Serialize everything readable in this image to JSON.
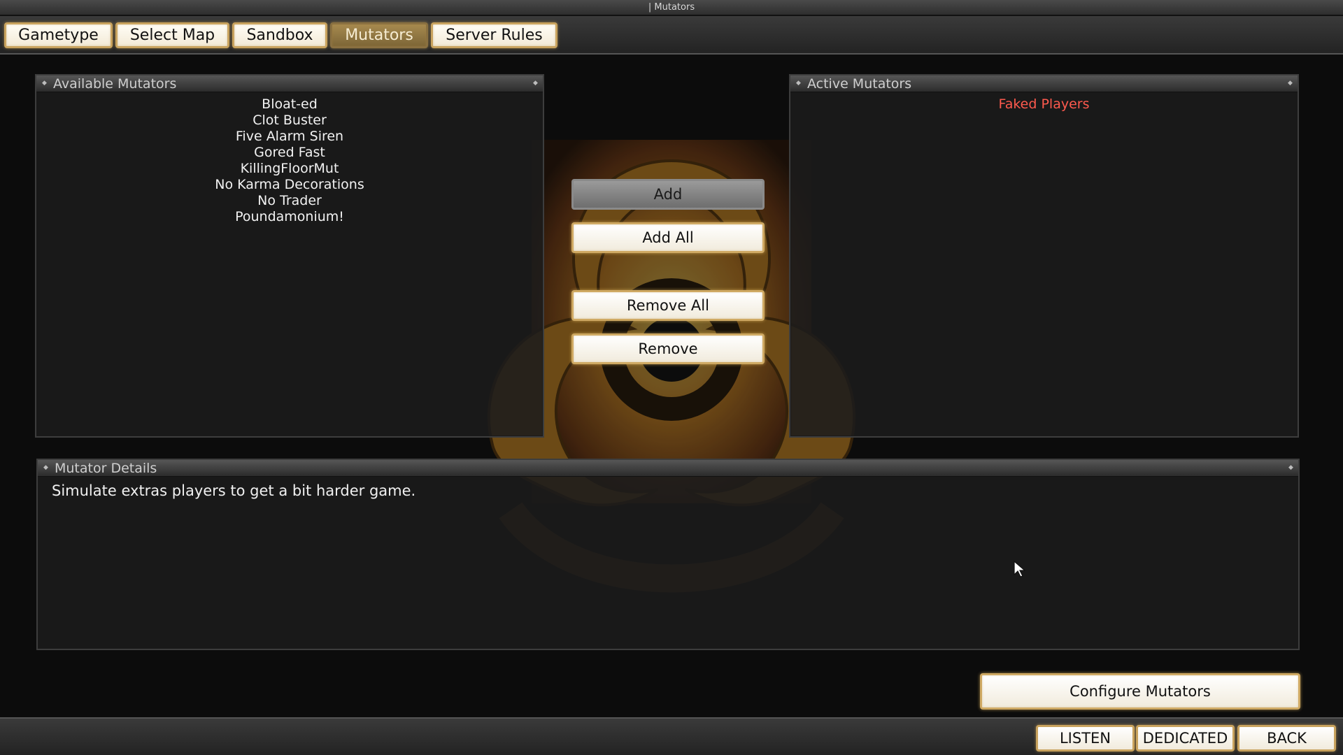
{
  "window": {
    "title": "| Mutators"
  },
  "tabs": [
    {
      "label": "Gametype"
    },
    {
      "label": "Select Map"
    },
    {
      "label": "Sandbox"
    },
    {
      "label": "Mutators",
      "active": true
    },
    {
      "label": "Server Rules"
    }
  ],
  "available": {
    "title": "Available Mutators",
    "items": [
      "Bloat-ed",
      "Clot Buster",
      "Five Alarm Siren",
      "Gored Fast",
      "KillingFloorMut",
      "No Karma Decorations",
      "No Trader",
      "Poundamonium!"
    ]
  },
  "active": {
    "title": "Active Mutators",
    "items": [
      "Faked Players"
    ],
    "selected_color": "#ff5a4e"
  },
  "actions": {
    "add": "Add",
    "add_all": "Add All",
    "remove_all": "Remove All",
    "remove": "Remove"
  },
  "details": {
    "title": "Mutator Details",
    "text": "Simulate extras players to get a bit harder game."
  },
  "configure": {
    "label": "Configure Mutators"
  },
  "footer": {
    "listen": "LISTEN",
    "dedicated": "DEDICATED",
    "back": "BACK"
  },
  "colors": {
    "accent_border": "#c9a35e",
    "active_tab": "#8a7040"
  },
  "icons": {
    "background": "biohazard-icon",
    "cursor": "mouse-cursor-icon"
  }
}
